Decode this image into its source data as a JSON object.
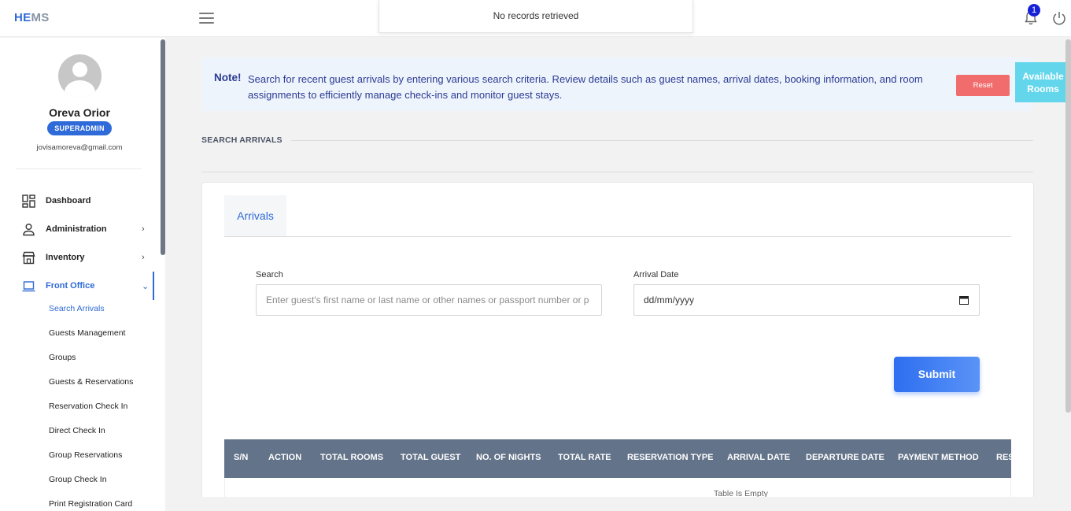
{
  "app": {
    "logo_he": "HE",
    "logo_ms": "MS"
  },
  "toast": {
    "message": "No records retrieved"
  },
  "header": {
    "notification_count": "1"
  },
  "user": {
    "name": "Oreva Orior",
    "role": "SUPERADMIN",
    "email": "jovisamoreva@gmail.com"
  },
  "sidebar": {
    "items": [
      {
        "label": "Dashboard",
        "icon": "dashboard-icon"
      },
      {
        "label": "Administration",
        "icon": "person-icon"
      },
      {
        "label": "Inventory",
        "icon": "store-icon"
      },
      {
        "label": "Front Office",
        "icon": "laptop-icon"
      }
    ],
    "sub_items": [
      "Search Arrivals",
      "Guests Management",
      "Groups",
      "Guests & Reservations",
      "Reservation Check In",
      "Direct Check In",
      "Group Reservations",
      "Group Check In",
      "Print Registration Card"
    ]
  },
  "note": {
    "title": "Note!",
    "text": "Search for recent guest arrivals by entering various search criteria. Review details such as guest names, arrival dates, booking information, and room assignments to efficiently manage check-ins and monitor guest stays."
  },
  "buttons": {
    "reset": "Reset",
    "available_rooms": "Available Rooms",
    "submit": "Submit"
  },
  "section": {
    "title": "SEARCH ARRIVALS"
  },
  "tabs": {
    "arrivals": "Arrivals"
  },
  "form": {
    "search_label": "Search",
    "search_placeholder": "Enter  guest's first name or last name or other names or passport number or p",
    "arrival_label": "Arrival Date",
    "arrival_value": "dd/mm/yyyy"
  },
  "table": {
    "columns": [
      "S/N",
      "ACTION",
      "TOTAL ROOMS",
      "TOTAL GUEST",
      "NO. OF NIGHTS",
      "TOTAL RATE",
      "RESERVATION TYPE",
      "ARRIVAL DATE",
      "DEPARTURE DATE",
      "PAYMENT METHOD",
      "RES"
    ],
    "empty_text": "Table Is Empty"
  },
  "colors": {
    "accent": "#2e6ad6",
    "reset": "#f16d6d",
    "available": "#63d6ec",
    "table_header": "#637389"
  }
}
